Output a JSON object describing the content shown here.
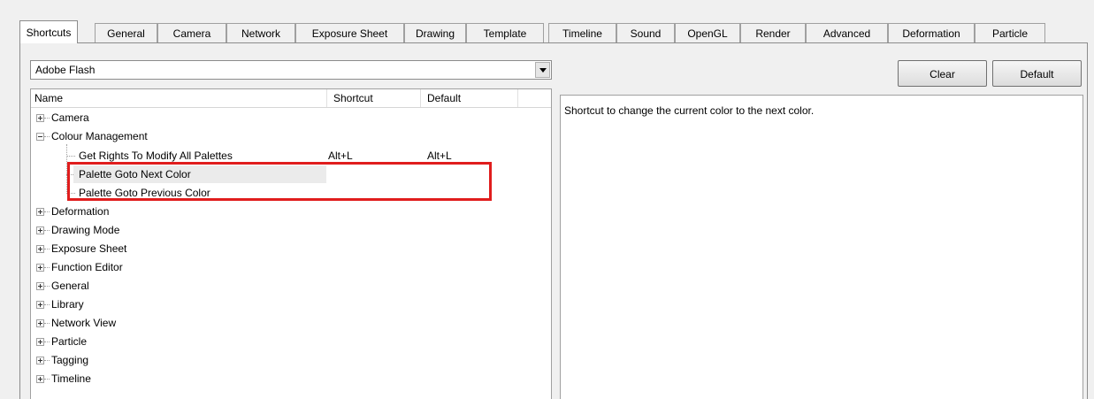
{
  "tabs": [
    {
      "label": "Shortcuts",
      "active": true
    },
    {
      "label": "General"
    },
    {
      "label": "Camera"
    },
    {
      "label": "Network"
    },
    {
      "label": "Exposure Sheet"
    },
    {
      "label": "Drawing"
    },
    {
      "label": "Template"
    },
    {
      "label": "Timeline"
    },
    {
      "label": "Sound"
    },
    {
      "label": "OpenGL"
    },
    {
      "label": "Render"
    },
    {
      "label": "Advanced"
    },
    {
      "label": "Deformation"
    },
    {
      "label": "Particle"
    }
  ],
  "preset": {
    "value": "Adobe Flash"
  },
  "tree": {
    "columns": {
      "name": "Name",
      "shortcut": "Shortcut",
      "default": "Default"
    },
    "rows": [
      {
        "label": "Camera",
        "expander": "plus"
      },
      {
        "label": "Colour Management",
        "expander": "minus"
      },
      {
        "label": "Get Rights To Modify All Palettes",
        "shortcut": "Alt+L",
        "default": "Alt+L"
      },
      {
        "label": "Palette Goto Next Color",
        "selected": true
      },
      {
        "label": "Palette Goto Previous Color"
      },
      {
        "label": "Deformation",
        "expander": "plus"
      },
      {
        "label": "Drawing Mode",
        "expander": "plus"
      },
      {
        "label": "Exposure Sheet",
        "expander": "plus"
      },
      {
        "label": "Function Editor",
        "expander": "plus"
      },
      {
        "label": "General",
        "expander": "plus"
      },
      {
        "label": "Library",
        "expander": "plus"
      },
      {
        "label": "Network View",
        "expander": "plus"
      },
      {
        "label": "Particle",
        "expander": "plus"
      },
      {
        "label": "Tagging",
        "expander": "plus"
      },
      {
        "label": "Timeline",
        "expander": "plus"
      }
    ]
  },
  "buttons": {
    "clear": "Clear",
    "default": "Default"
  },
  "description": "Shortcut to change the current color to the next color.",
  "colors": {
    "highlight": "#e01d1d",
    "selection": "#ebebeb"
  }
}
